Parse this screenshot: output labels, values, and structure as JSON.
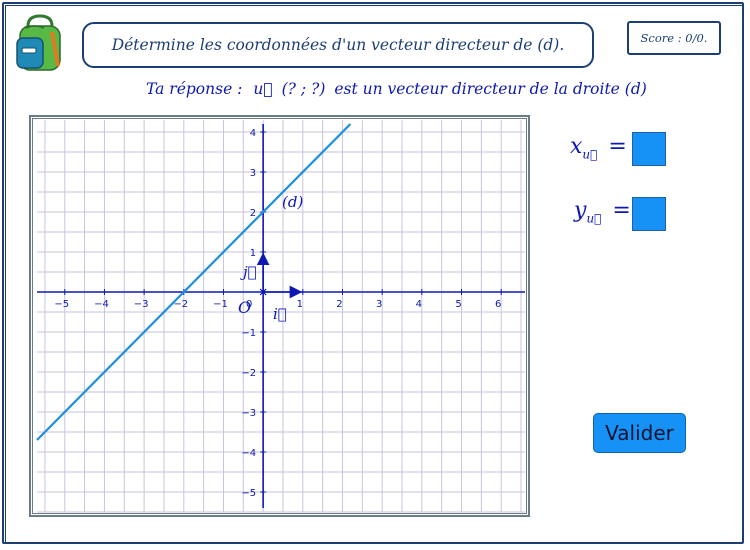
{
  "header": {
    "instruction": "Détermine les coordonnées d'un vecteur directeur de (d).",
    "score": "Score : 0/0."
  },
  "answer_line": {
    "prefix": "Ta réponse :",
    "vector": "u⃗",
    "coords": "(? ; ?)",
    "suffix": "est un vecteur directeur de la droite (d)"
  },
  "inputs": {
    "x_label": "x",
    "x_sub": "u⃗",
    "y_label": "y",
    "y_sub": "u⃗",
    "equals": "=",
    "x_value": "",
    "y_value": ""
  },
  "button": {
    "validate_label": "Valider"
  },
  "graph": {
    "line_label": "(d)",
    "origin_label": "O",
    "i_label": "i⃗",
    "j_label": "j⃗",
    "x_ticks": [
      "−5",
      "−4",
      "−3",
      "−2",
      "−1",
      "0",
      "1",
      "2",
      "3",
      "4",
      "5",
      "6"
    ],
    "y_ticks": [
      "4",
      "3",
      "2",
      "1",
      "−1",
      "−2",
      "−3",
      "−4",
      "−5"
    ]
  },
  "chart_data": {
    "type": "line",
    "xlim": [
      -5.7,
      6.6
    ],
    "ylim": [
      -5.5,
      4.3
    ],
    "grid": true,
    "series": [
      {
        "name": "(d)",
        "x": [
          -5.7,
          2.2
        ],
        "y": [
          -3.7,
          4.2
        ]
      }
    ],
    "colors": {
      "line": "#1c8fe0",
      "axes": "#0d18b4",
      "grid": "#c9c3dd",
      "text": "#0d18b4"
    }
  },
  "colors": {
    "frame": "#1c3e75",
    "accent": "#1691f5",
    "text": "#0d18b4"
  }
}
